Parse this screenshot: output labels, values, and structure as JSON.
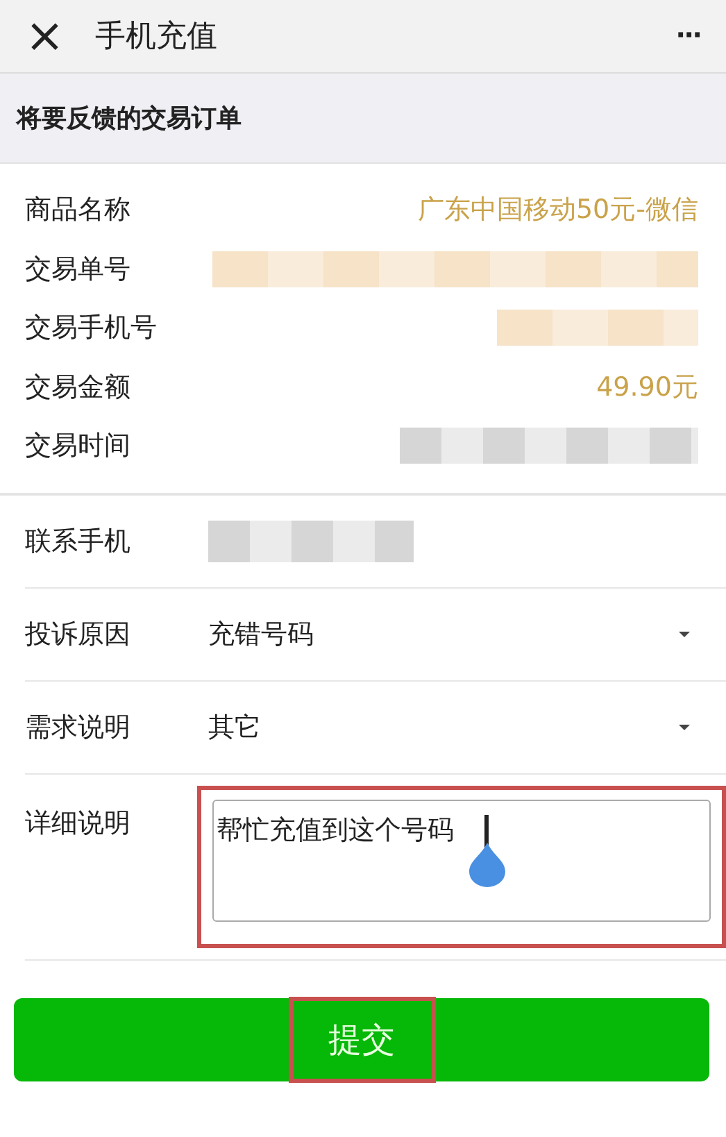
{
  "header": {
    "close": "×",
    "title": "手机充值",
    "more": "···"
  },
  "section_title": "将要反馈的交易订单",
  "order_rows": [
    {
      "label": "商品名称",
      "kind": "text",
      "value": "广东中国移动50元-微信",
      "highlight": true
    },
    {
      "label": "交易单号",
      "kind": "redacted",
      "highlight": true
    },
    {
      "label": "交易手机号",
      "kind": "redacted",
      "highlight": true
    },
    {
      "label": "交易金额",
      "kind": "text",
      "value": "49.90元",
      "highlight": true
    },
    {
      "label": "交易时间",
      "kind": "redacted",
      "highlight": false
    }
  ],
  "form_rows": [
    {
      "label": "联系手机",
      "kind": "redacted"
    },
    {
      "label": "投诉原因",
      "kind": "select",
      "value": "充错号码"
    },
    {
      "label": "需求说明",
      "kind": "select",
      "value": "其它"
    },
    {
      "label": "详细说明",
      "kind": "textarea",
      "value": "帮忙充值到这个号码",
      "annotated": true
    }
  ],
  "submit": {
    "label": "提交",
    "annotated": true
  }
}
